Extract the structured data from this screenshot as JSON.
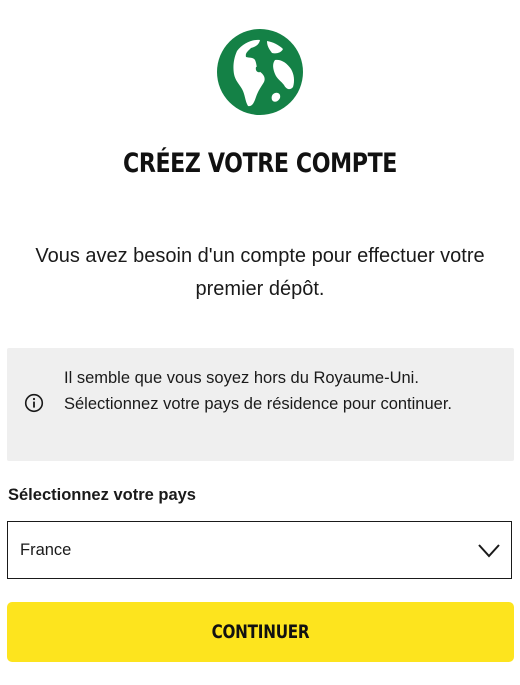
{
  "header": {
    "icon": "globe-icon",
    "title": "CRÉEZ VOTRE COMPTE",
    "subtitle": "Vous avez besoin d'un compte pour effectuer votre premier dépôt."
  },
  "notice": {
    "icon": "info-icon",
    "text": "Il semble que vous soyez hors du Royaume-Uni. Sélectionnez votre pays de résidence pour continuer."
  },
  "country_select": {
    "label": "Sélectionnez votre pays",
    "value": "France",
    "icon": "chevron-down-icon"
  },
  "continue_button": {
    "label": "CONTINUER"
  },
  "colors": {
    "globe": "#148146",
    "button": "#fde41e",
    "notice_bg": "#efefef",
    "text": "#1a1a1a"
  }
}
